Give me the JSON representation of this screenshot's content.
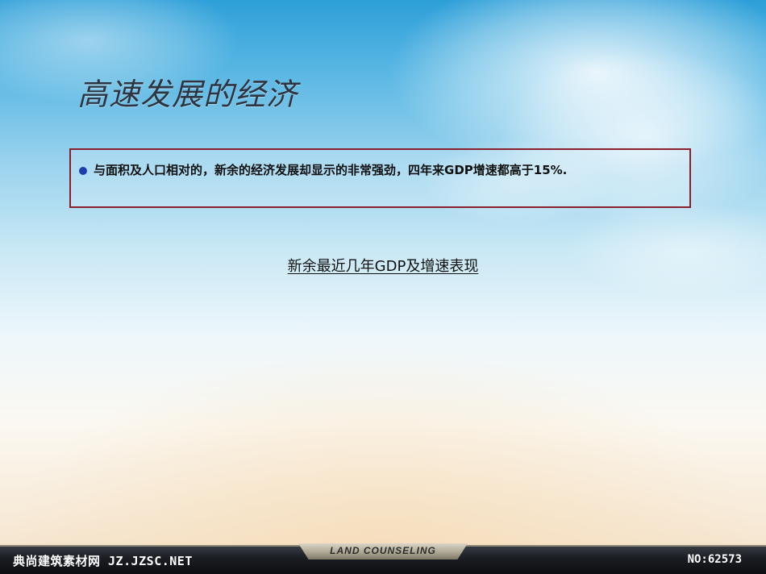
{
  "slide": {
    "title": "高速发展的经济",
    "bullet": "与面积及人口相对的，新余的经济发展却显示的非常强劲，四年来GDP增速都高于15%.",
    "subtitle": "新余最近几年GDP及增速表现"
  },
  "footer": {
    "left_text": "典尚建筑素材网 JZ.JZSC.NET",
    "logo_text": "LAND COUNSELING",
    "right_text": "NO:62573"
  },
  "colors": {
    "box_border": "#8c1f2c",
    "bullet_dot": "#1f3da8",
    "sky_top": "#2d9fd8"
  }
}
